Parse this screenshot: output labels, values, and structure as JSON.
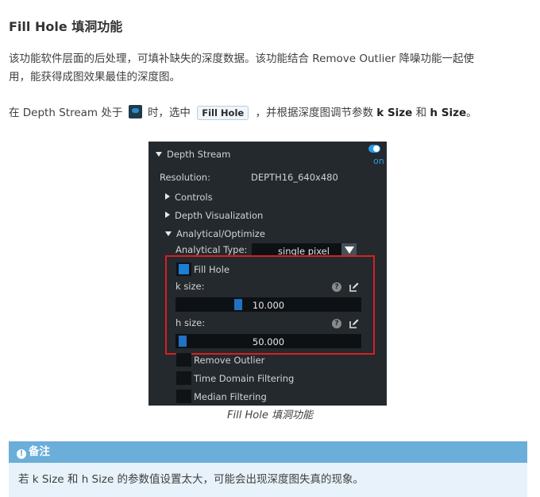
{
  "heading": "Fill Hole 填洞功能",
  "para1": {
    "line1": "该功能软件层面的后处理，可填补缺失的深度数据。该功能结合 Remove Outlier 降噪功能一起使",
    "line2": "用，能获得成图效果最佳的深度图。"
  },
  "para2": {
    "prefix": "在 Depth Stream 处于",
    "mid": "时，选中",
    "button_label": "Fill Hole",
    "suffix": "，并根据深度图调节参数",
    "k": "k Size",
    "and": "和",
    "h": "h Size",
    "end": "。"
  },
  "panel": {
    "title": "Depth Stream",
    "toggle_text": "on",
    "resolution_label": "Resolution:",
    "resolution_value": "DEPTH16_640x480",
    "controls": "Controls",
    "depth_vis": "Depth Visualization",
    "analytical": "Analytical/Optimize",
    "analytical_type_label": "Analytical Type:",
    "analytical_type_value": "single pixel",
    "fill_hole": "Fill Hole",
    "k_size_label": "k size:",
    "k_size_value": "10.000",
    "k_size_fraction": 0.33,
    "h_size_label": "h size:",
    "h_size_value": "50.000",
    "h_size_fraction": 0.02,
    "remove_outlier": "Remove Outlier",
    "time_domain": "Time Domain Filtering",
    "median": "Median Filtering",
    "help_glyph": "?"
  },
  "caption": "Fill Hole 填洞功能",
  "note": {
    "title": "备注",
    "icon_glyph": "!",
    "body": "若 k Size 和 h Size 的参数值设置太大，可能会出现深度图失真的现象。"
  },
  "colors": {
    "accent_blue": "#2b9be6",
    "highlight_red": "#d62021",
    "note_header": "#6aaed9",
    "note_body": "#e7f2fa"
  }
}
